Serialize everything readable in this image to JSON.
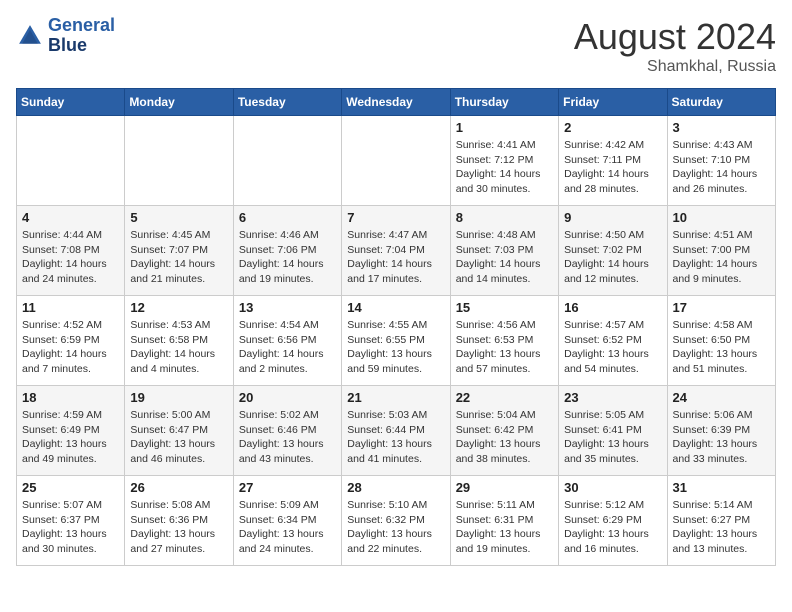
{
  "header": {
    "logo_line1": "General",
    "logo_line2": "Blue",
    "main_title": "August 2024",
    "subtitle": "Shamkhal, Russia"
  },
  "days_of_week": [
    "Sunday",
    "Monday",
    "Tuesday",
    "Wednesday",
    "Thursday",
    "Friday",
    "Saturday"
  ],
  "weeks": [
    {
      "days": [
        {
          "number": "",
          "info": ""
        },
        {
          "number": "",
          "info": ""
        },
        {
          "number": "",
          "info": ""
        },
        {
          "number": "",
          "info": ""
        },
        {
          "number": "1",
          "info": "Sunrise: 4:41 AM\nSunset: 7:12 PM\nDaylight: 14 hours\nand 30 minutes."
        },
        {
          "number": "2",
          "info": "Sunrise: 4:42 AM\nSunset: 7:11 PM\nDaylight: 14 hours\nand 28 minutes."
        },
        {
          "number": "3",
          "info": "Sunrise: 4:43 AM\nSunset: 7:10 PM\nDaylight: 14 hours\nand 26 minutes."
        }
      ]
    },
    {
      "days": [
        {
          "number": "4",
          "info": "Sunrise: 4:44 AM\nSunset: 7:08 PM\nDaylight: 14 hours\nand 24 minutes."
        },
        {
          "number": "5",
          "info": "Sunrise: 4:45 AM\nSunset: 7:07 PM\nDaylight: 14 hours\nand 21 minutes."
        },
        {
          "number": "6",
          "info": "Sunrise: 4:46 AM\nSunset: 7:06 PM\nDaylight: 14 hours\nand 19 minutes."
        },
        {
          "number": "7",
          "info": "Sunrise: 4:47 AM\nSunset: 7:04 PM\nDaylight: 14 hours\nand 17 minutes."
        },
        {
          "number": "8",
          "info": "Sunrise: 4:48 AM\nSunset: 7:03 PM\nDaylight: 14 hours\nand 14 minutes."
        },
        {
          "number": "9",
          "info": "Sunrise: 4:50 AM\nSunset: 7:02 PM\nDaylight: 14 hours\nand 12 minutes."
        },
        {
          "number": "10",
          "info": "Sunrise: 4:51 AM\nSunset: 7:00 PM\nDaylight: 14 hours\nand 9 minutes."
        }
      ]
    },
    {
      "days": [
        {
          "number": "11",
          "info": "Sunrise: 4:52 AM\nSunset: 6:59 PM\nDaylight: 14 hours\nand 7 minutes."
        },
        {
          "number": "12",
          "info": "Sunrise: 4:53 AM\nSunset: 6:58 PM\nDaylight: 14 hours\nand 4 minutes."
        },
        {
          "number": "13",
          "info": "Sunrise: 4:54 AM\nSunset: 6:56 PM\nDaylight: 14 hours\nand 2 minutes."
        },
        {
          "number": "14",
          "info": "Sunrise: 4:55 AM\nSunset: 6:55 PM\nDaylight: 13 hours\nand 59 minutes."
        },
        {
          "number": "15",
          "info": "Sunrise: 4:56 AM\nSunset: 6:53 PM\nDaylight: 13 hours\nand 57 minutes."
        },
        {
          "number": "16",
          "info": "Sunrise: 4:57 AM\nSunset: 6:52 PM\nDaylight: 13 hours\nand 54 minutes."
        },
        {
          "number": "17",
          "info": "Sunrise: 4:58 AM\nSunset: 6:50 PM\nDaylight: 13 hours\nand 51 minutes."
        }
      ]
    },
    {
      "days": [
        {
          "number": "18",
          "info": "Sunrise: 4:59 AM\nSunset: 6:49 PM\nDaylight: 13 hours\nand 49 minutes."
        },
        {
          "number": "19",
          "info": "Sunrise: 5:00 AM\nSunset: 6:47 PM\nDaylight: 13 hours\nand 46 minutes."
        },
        {
          "number": "20",
          "info": "Sunrise: 5:02 AM\nSunset: 6:46 PM\nDaylight: 13 hours\nand 43 minutes."
        },
        {
          "number": "21",
          "info": "Sunrise: 5:03 AM\nSunset: 6:44 PM\nDaylight: 13 hours\nand 41 minutes."
        },
        {
          "number": "22",
          "info": "Sunrise: 5:04 AM\nSunset: 6:42 PM\nDaylight: 13 hours\nand 38 minutes."
        },
        {
          "number": "23",
          "info": "Sunrise: 5:05 AM\nSunset: 6:41 PM\nDaylight: 13 hours\nand 35 minutes."
        },
        {
          "number": "24",
          "info": "Sunrise: 5:06 AM\nSunset: 6:39 PM\nDaylight: 13 hours\nand 33 minutes."
        }
      ]
    },
    {
      "days": [
        {
          "number": "25",
          "info": "Sunrise: 5:07 AM\nSunset: 6:37 PM\nDaylight: 13 hours\nand 30 minutes."
        },
        {
          "number": "26",
          "info": "Sunrise: 5:08 AM\nSunset: 6:36 PM\nDaylight: 13 hours\nand 27 minutes."
        },
        {
          "number": "27",
          "info": "Sunrise: 5:09 AM\nSunset: 6:34 PM\nDaylight: 13 hours\nand 24 minutes."
        },
        {
          "number": "28",
          "info": "Sunrise: 5:10 AM\nSunset: 6:32 PM\nDaylight: 13 hours\nand 22 minutes."
        },
        {
          "number": "29",
          "info": "Sunrise: 5:11 AM\nSunset: 6:31 PM\nDaylight: 13 hours\nand 19 minutes."
        },
        {
          "number": "30",
          "info": "Sunrise: 5:12 AM\nSunset: 6:29 PM\nDaylight: 13 hours\nand 16 minutes."
        },
        {
          "number": "31",
          "info": "Sunrise: 5:14 AM\nSunset: 6:27 PM\nDaylight: 13 hours\nand 13 minutes."
        }
      ]
    }
  ]
}
